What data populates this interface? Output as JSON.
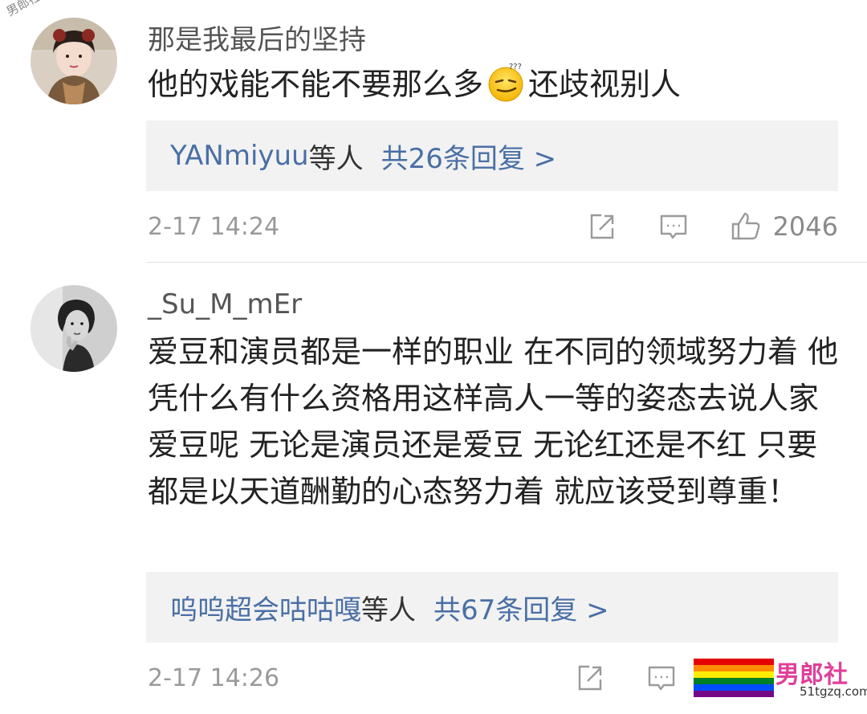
{
  "watermark": {
    "top_left": "男郎社",
    "brand_name": "男郎社",
    "brand_url": "51tgzq.com"
  },
  "comments": [
    {
      "username": "那是我最后的坚持",
      "text_before_emoji": "他的戏能不能不要那么多",
      "emoji": "dizzy-smirk-emoji",
      "text_after_emoji": "还歧视别人",
      "reply_summary": {
        "who": "YANmiyuu",
        "sep": "等人",
        "count": "共26条回复 >"
      },
      "timestamp": "2-17 14:24",
      "likes": "2046"
    },
    {
      "username": "_Su_M_mEr",
      "text": "爱豆和演员都是一样的职业 在不同的领域努力着 他凭什么有什么资格用这样高人一等的姿态去说人家爱豆呢 无论是演员还是爱豆 无论红还是不红 只要都是以天道酬勤的心态努力着 就应该受到尊重！",
      "reply_summary": {
        "who": "呜呜超会咕咕嘎",
        "sep": "等人",
        "count": "共67条回复 >"
      },
      "timestamp": "2-17 14:26"
    }
  ],
  "icons": [
    "share-icon",
    "comment-icon",
    "like-icon"
  ],
  "colors": {
    "link": "#4a6fa5",
    "reply_bg": "#f2f2f2",
    "meta": "#9a9a9a"
  }
}
